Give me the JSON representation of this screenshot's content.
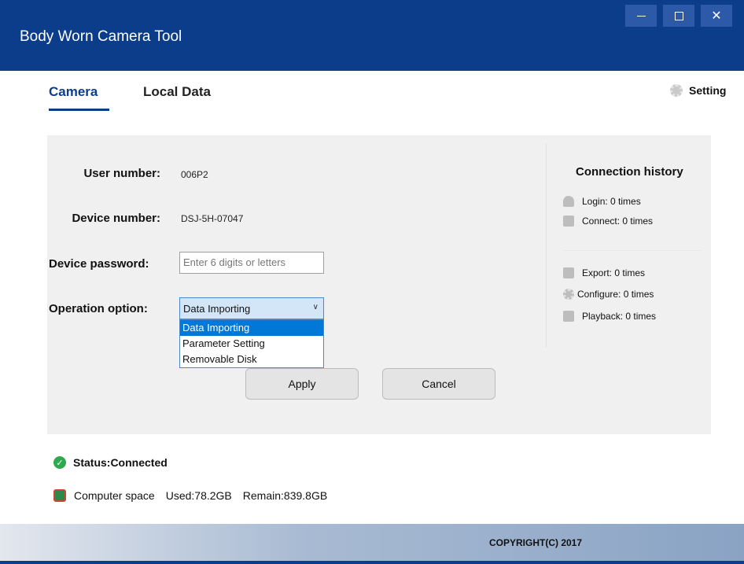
{
  "window": {
    "title": "Body Worn Camera Tool",
    "minimize_label": "—",
    "close_label": "✕"
  },
  "tabs": [
    {
      "label": "Camera",
      "active": true
    },
    {
      "label": "Local Data",
      "active": false
    }
  ],
  "setting": {
    "label": "Setting",
    "icon": "gear-icon"
  },
  "form": {
    "user_number_label": "User number:",
    "user_number_value": "006P2",
    "device_number_label": "Device number:",
    "device_number_value": "DSJ-5H-07047",
    "device_password_label": "Device password:",
    "device_password_placeholder": "Enter 6 digits or letters",
    "operation_label": "Operation option:",
    "operation_selected": "Data Importing",
    "operation_options": [
      "Data Importing",
      "Parameter Setting",
      "Removable Disk"
    ],
    "apply_label": "Apply",
    "cancel_label": "Cancel"
  },
  "history": {
    "title": "Connection history",
    "login": "Login: 0 times",
    "connect": "Connect: 0 times",
    "export": "Export: 0 times",
    "configure": "Configure: 0 times",
    "playback": "Playback: 0 times"
  },
  "status": {
    "text": "Status:Connected",
    "space_label": "Computer space",
    "used": "Used:78.2GB",
    "remain": "Remain:839.8GB"
  },
  "footer": {
    "copyright": "COPYRIGHT(C) 2017"
  },
  "colors": {
    "accent": "#0c3d8a",
    "status_ok": "#2fa84f",
    "selection": "#0078d7"
  }
}
